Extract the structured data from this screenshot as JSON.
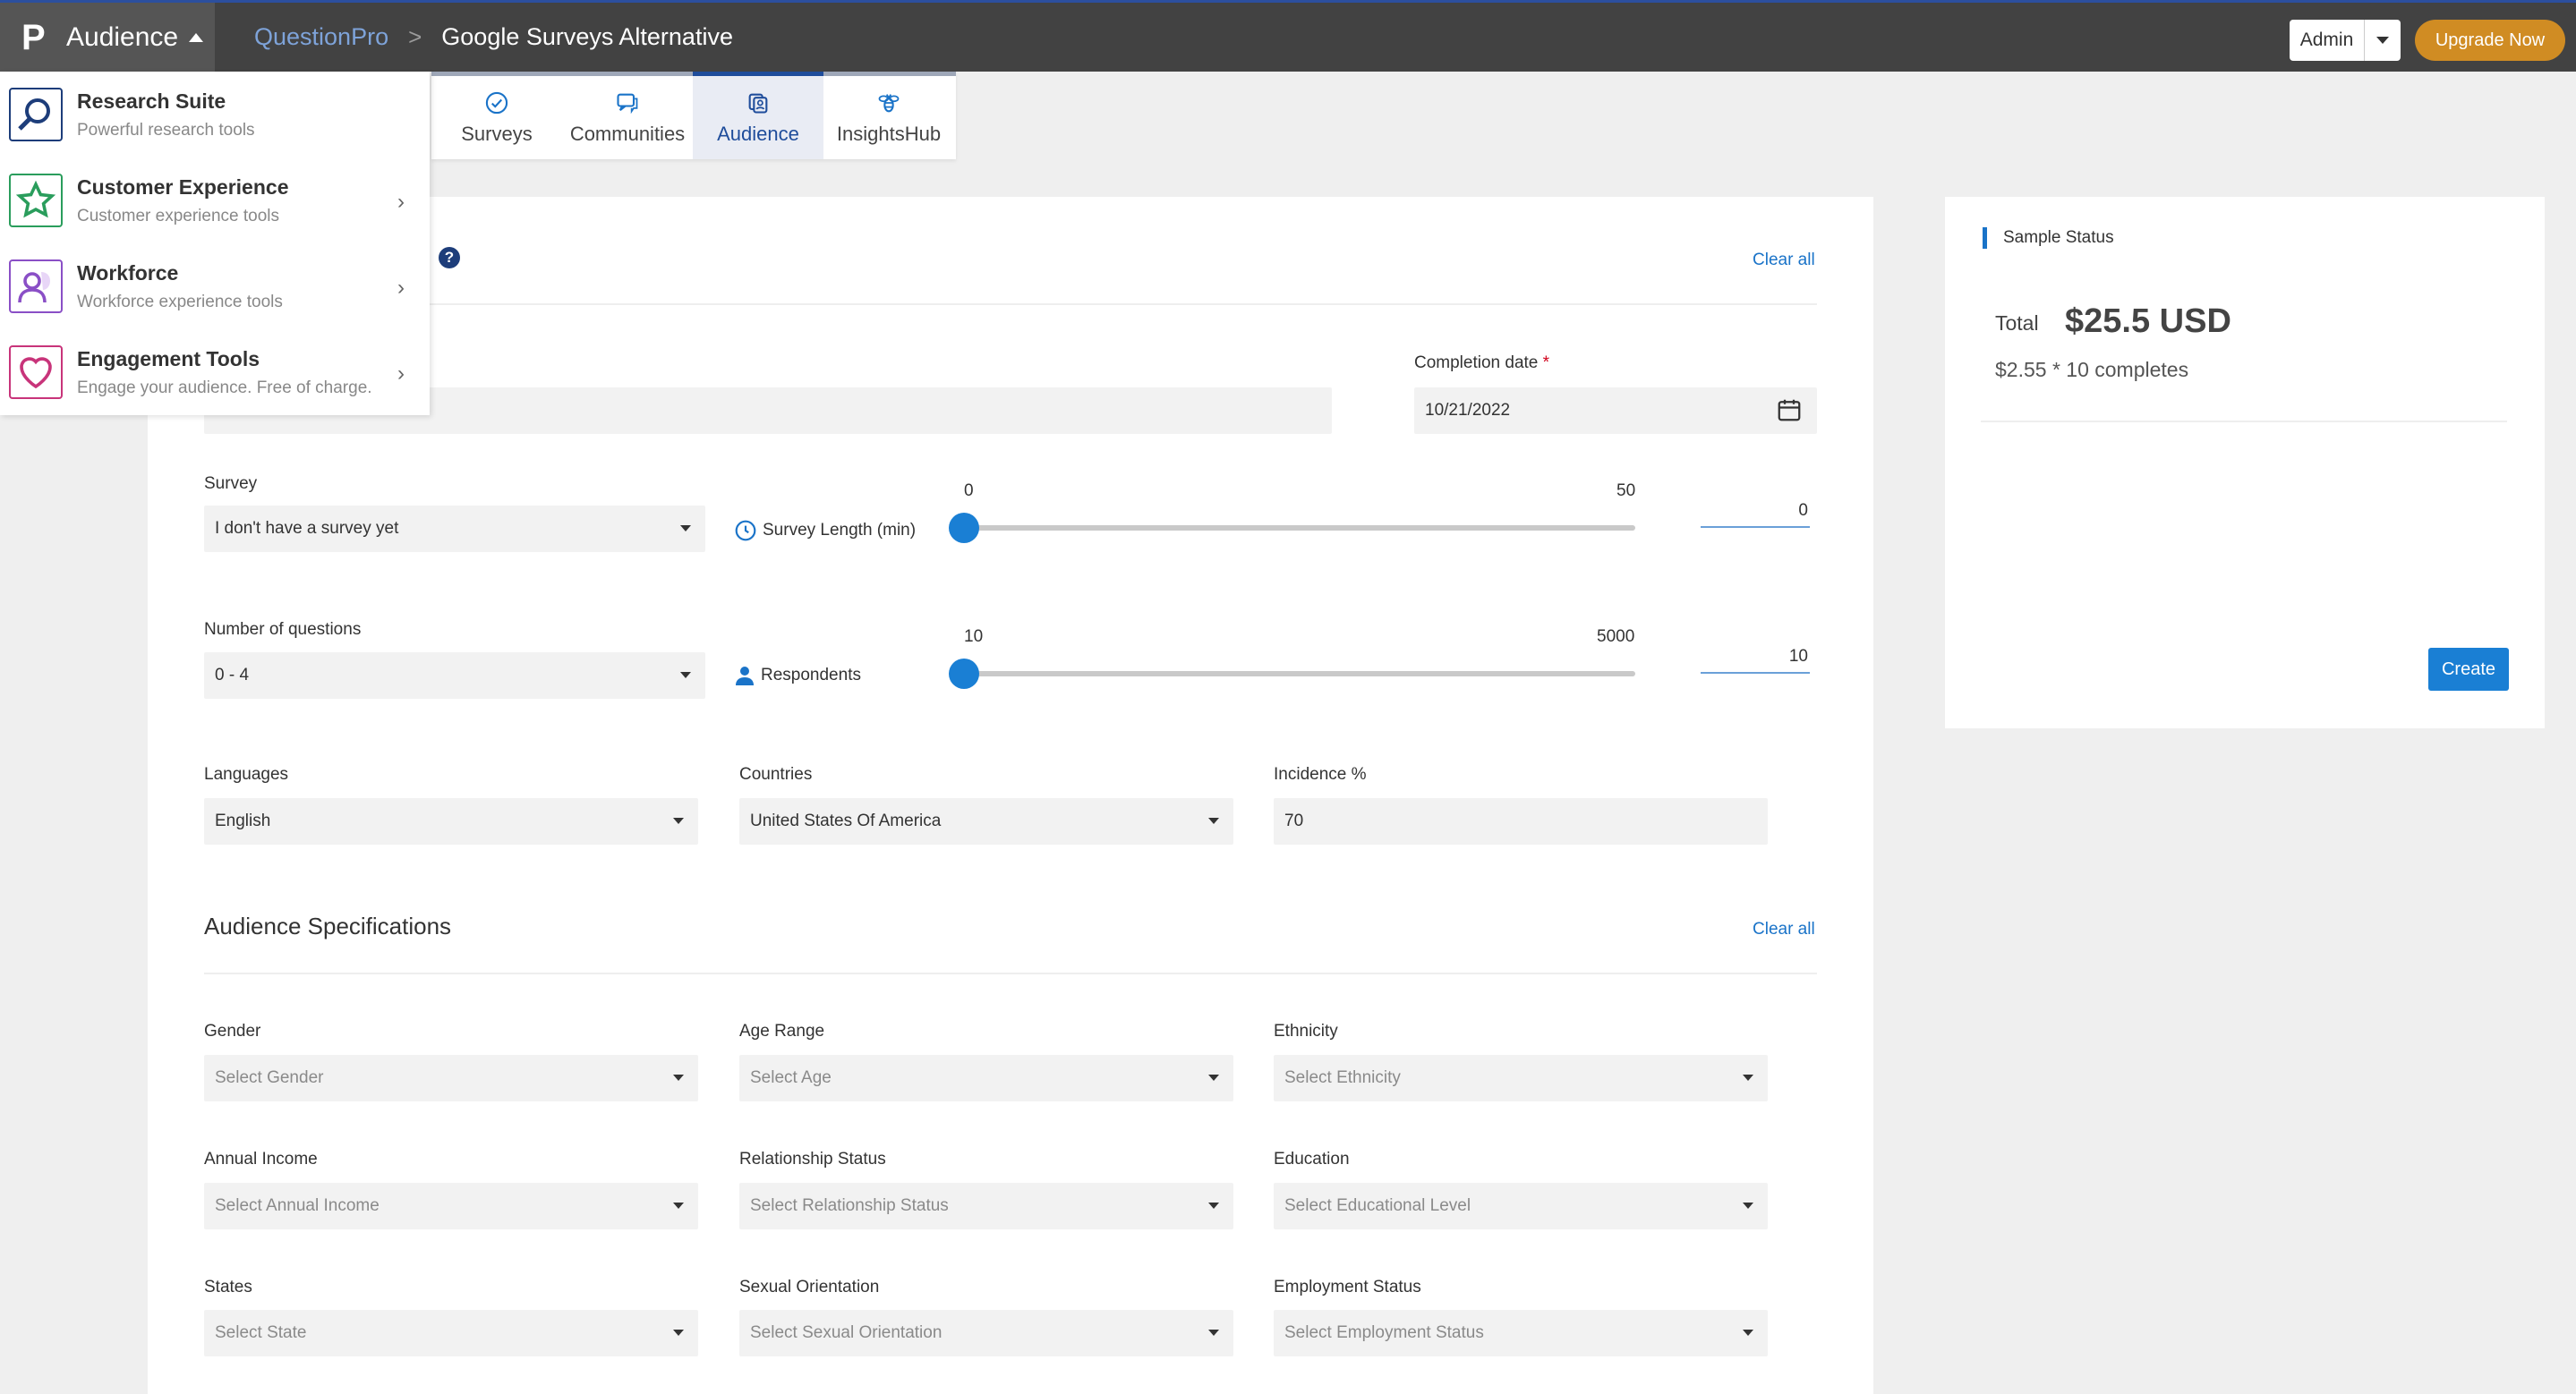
{
  "topbar": {
    "app_name": "Audience",
    "breadcrumb_brand": "QuestionPro",
    "breadcrumb_sep": ">",
    "breadcrumb_page": "Google Surveys Alternative",
    "admin_label": "Admin",
    "upgrade_label": "Upgrade Now"
  },
  "product_tabs": [
    {
      "label": "Surveys",
      "icon": "check-circle-icon"
    },
    {
      "label": "Communities",
      "icon": "chat-bubble-icon"
    },
    {
      "label": "Audience",
      "icon": "audience-icon",
      "active": true
    },
    {
      "label": "InsightsHub",
      "icon": "bee-icon"
    }
  ],
  "suite_menu": [
    {
      "title": "Research Suite",
      "subtitle": "Powerful research tools",
      "icon": "magnifier-icon",
      "color": "#1d3d7a"
    },
    {
      "title": "Customer Experience",
      "subtitle": "Customer experience tools",
      "icon": "star-icon",
      "color": "#2a9d5c"
    },
    {
      "title": "Workforce",
      "subtitle": "Workforce experience tools",
      "icon": "person-icon",
      "color": "#8a4fc6"
    },
    {
      "title": "Engagement Tools",
      "subtitle": "Engage your audience. Free of charge.",
      "icon": "heart-icon",
      "color": "#c8347a"
    }
  ],
  "form": {
    "clear_all": "Clear all",
    "completion_date_label": "Completion date",
    "required_mark": "*",
    "completion_date_value": "10/21/2022",
    "survey_label": "Survey",
    "survey_value": "I don't have a survey yet",
    "survey_length_label": "Survey Length (min)",
    "survey_length_min": "0",
    "survey_length_max": "50",
    "survey_length_value": "0",
    "num_questions_label": "Number of questions",
    "num_questions_value": "0 - 4",
    "respondents_label": "Respondents",
    "respondents_min": "10",
    "respondents_max": "5000",
    "respondents_value": "10",
    "languages_label": "Languages",
    "languages_value": "English",
    "countries_label": "Countries",
    "countries_value": "United States Of America",
    "incidence_label": "Incidence %",
    "incidence_value": "70"
  },
  "audience_specs": {
    "title": "Audience Specifications",
    "clear_all": "Clear all",
    "fields": [
      {
        "label": "Gender",
        "placeholder": "Select Gender"
      },
      {
        "label": "Age Range",
        "placeholder": "Select Age"
      },
      {
        "label": "Ethnicity",
        "placeholder": "Select Ethnicity"
      },
      {
        "label": "Annual Income",
        "placeholder": "Select Annual Income"
      },
      {
        "label": "Relationship Status",
        "placeholder": "Select Relationship Status"
      },
      {
        "label": "Education",
        "placeholder": "Select Educational Level"
      },
      {
        "label": "States",
        "placeholder": "Select State"
      },
      {
        "label": "Sexual Orientation",
        "placeholder": "Select Sexual Orientation"
      },
      {
        "label": "Employment Status",
        "placeholder": "Select Employment Status"
      }
    ]
  },
  "sample_status": {
    "title": "Sample Status",
    "total_label": "Total",
    "total_value": "$25.5 USD",
    "breakdown": "$2.55 * 10 completes",
    "create_label": "Create"
  },
  "colors": {
    "accent": "#1a7fd4",
    "topbar": "#424242",
    "upgrade": "#d08c23"
  }
}
